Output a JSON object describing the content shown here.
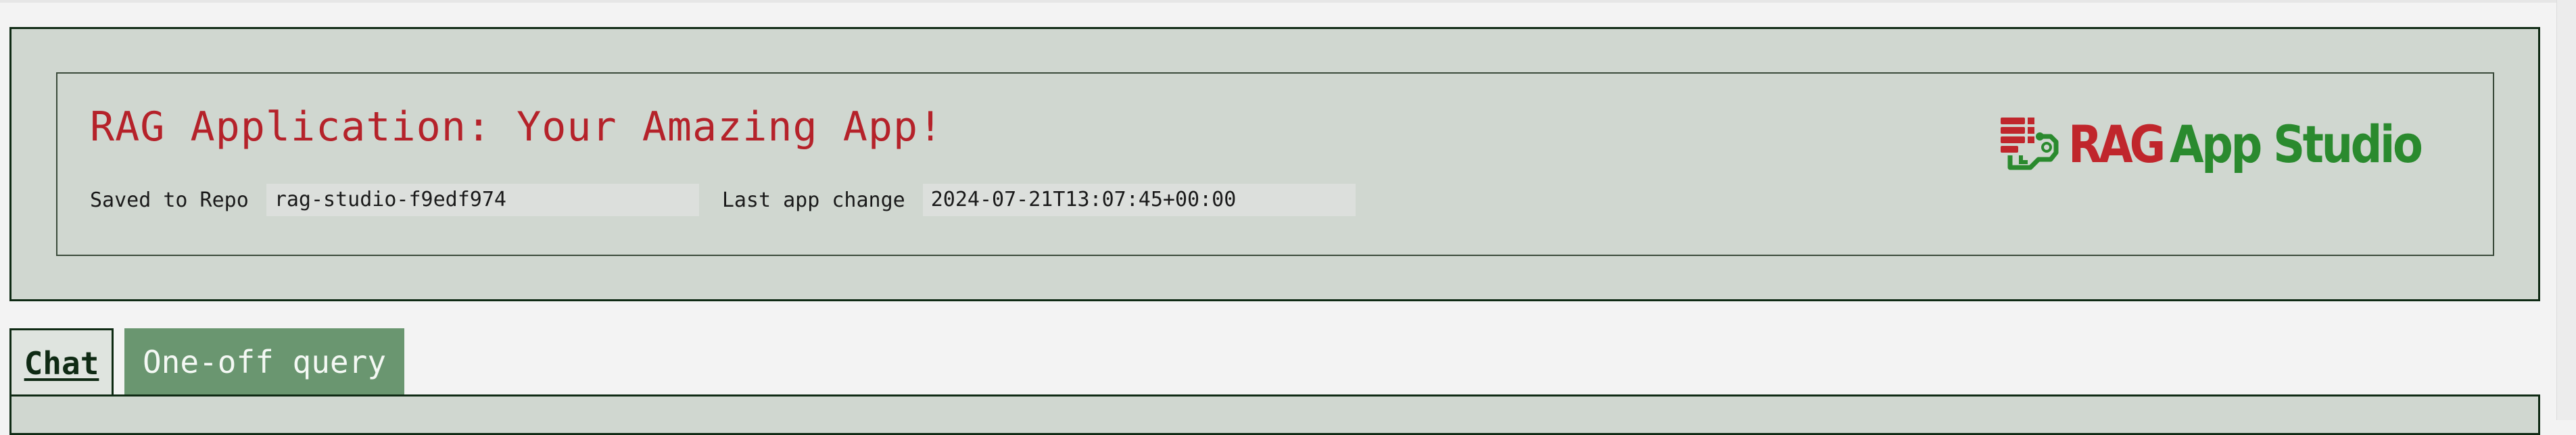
{
  "header": {
    "title": "RAG Application: Your Amazing App!",
    "saved_to_repo_label": "Saved to Repo",
    "saved_to_repo_value": "rag-studio-f9edf974",
    "last_change_label": "Last app change",
    "last_change_value": "2024-07-21T13:07:45+00:00"
  },
  "logo": {
    "icon": "database-circuit-icon",
    "word_red": "RAG",
    "word_green": "App Studio"
  },
  "tabs": [
    {
      "label": "Chat",
      "active": true
    },
    {
      "label": "One-off query",
      "active": false
    }
  ],
  "colors": {
    "title_red": "#b5222a",
    "panel_bg": "#d0d7d0",
    "border_dark": "#0f2a14",
    "tab_inactive_bg": "#6a9670",
    "logo_green": "#2a8a2e",
    "logo_red": "#c0262c"
  }
}
